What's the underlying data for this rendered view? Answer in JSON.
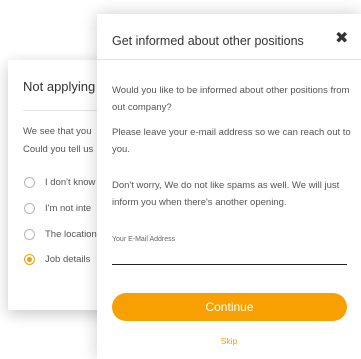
{
  "background_panel": {
    "title": "Not applying",
    "body_line1": "We see that you",
    "body_line2": "Could you tell us",
    "options": [
      {
        "label": "I don't know",
        "selected": false
      },
      {
        "label": "I'm not inte",
        "selected": false
      },
      {
        "label": "The location",
        "selected": false
      },
      {
        "label": "Job details",
        "selected": true
      }
    ]
  },
  "modal": {
    "title": "Get informed about other positions",
    "close_glyph": "✖",
    "paragraph1": "Would you like to be informed about other positions from out company?",
    "paragraph2": "Please leave your e-mail address so we can reach out to you.",
    "paragraph3": "Don't worry, We do not like spams as well. We will just inform you when there's another opening.",
    "email_label": "Your E-Mail Address",
    "email_value": "",
    "continue_label": "Continue",
    "skip_label": "Skip"
  },
  "colors": {
    "accent": "#f7a000",
    "text": "#333333",
    "muted_text": "#555555"
  },
  "icons": {
    "close": "close-icon",
    "radio": "radio-icon"
  }
}
